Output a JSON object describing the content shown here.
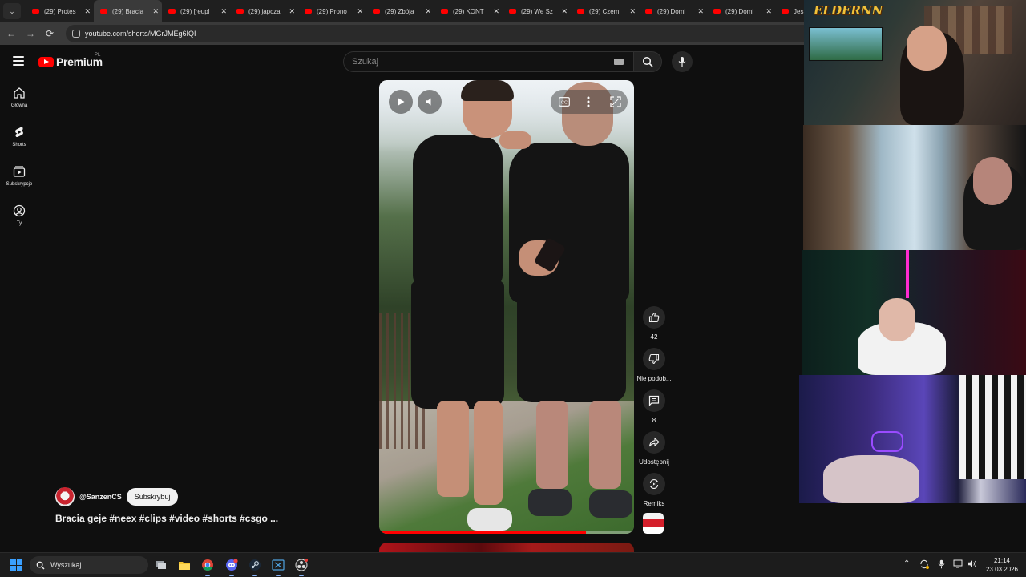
{
  "browser": {
    "tabs": [
      {
        "title": "(29) Protes",
        "active": false
      },
      {
        "title": "(29) Bracia",
        "active": true
      },
      {
        "title": "(29) [reupl",
        "active": false
      },
      {
        "title": "(29) japcza",
        "active": false
      },
      {
        "title": "(29) Prono",
        "active": false
      },
      {
        "title": "(29) Zbója",
        "active": false
      },
      {
        "title": "(29) KONT",
        "active": false
      },
      {
        "title": "(29) We Sz",
        "active": false
      },
      {
        "title": "(29) Czem",
        "active": false
      },
      {
        "title": "(29) Domi",
        "active": false
      },
      {
        "title": "(29) Domi",
        "active": false
      },
      {
        "title": "Jeste",
        "active": false
      }
    ],
    "url": "youtube.com/shorts/MGrJMEg6IQI"
  },
  "youtube": {
    "logo_text": "Premium",
    "region": "PL",
    "search_placeholder": "Szukaj",
    "guide": [
      {
        "label": "Główna",
        "icon": "home-icon"
      },
      {
        "label": "Shorts",
        "icon": "shorts-icon"
      },
      {
        "label": "Subskrypcje",
        "icon": "subscriptions-icon"
      },
      {
        "label": "Ty",
        "icon": "user-icon"
      }
    ],
    "short": {
      "channel": "@SanzenCS",
      "subscribe_label": "Subskrybuj",
      "title": "Bracia geje #neex #clips #video #shorts #csgo ...",
      "progress": 0.81
    },
    "actions": {
      "like_count": "42",
      "dislike_label": "Nie podob...",
      "comments_count": "8",
      "share_label": "Udostępnij",
      "remix_label": "Remiks"
    }
  },
  "overlay": {
    "cam1_brand": "ELDERNN"
  },
  "taskbar": {
    "search_placeholder": "Wyszukaj",
    "time": "21:14",
    "date": "23.03.2026"
  },
  "colors": {
    "youtube_red": "#ff0000",
    "background": "#0f0f0f",
    "subscribe_bg": "#f1f1f1"
  }
}
